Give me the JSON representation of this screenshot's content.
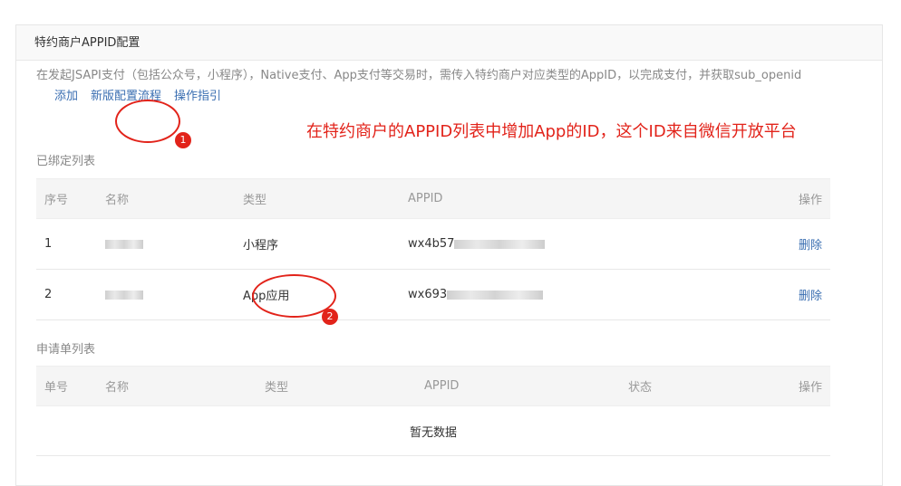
{
  "panel": {
    "title": "特约商户APPID配置"
  },
  "description": {
    "text": "在发起JSAPI支付（包括公众号，小程序），Native支付、App支付等交易时，需传入特约商户对应类型的AppID，以完成支付，并获取sub_openid",
    "links": [
      "添加",
      "新版配置流程",
      "操作指引"
    ]
  },
  "annotation": {
    "text": "在特约商户的APPID列表中增加App的ID，这个ID来自微信开放平台",
    "badges": [
      "1",
      "2"
    ],
    "color": "#e2231a"
  },
  "bound_list": {
    "label": "已绑定列表",
    "headers": [
      "序号",
      "名称",
      "类型",
      "APPID",
      "操作"
    ],
    "rows": [
      {
        "index": "1",
        "type": "小程序",
        "appid": "wx4b57",
        "action": "删除"
      },
      {
        "index": "2",
        "type": "App应用",
        "appid": "wx693",
        "action": "删除"
      }
    ]
  },
  "application_list": {
    "label": "申请单列表",
    "headers": [
      "单号",
      "名称",
      "类型",
      "APPID",
      "状态",
      "操作"
    ],
    "empty_text": "暂无数据"
  },
  "colors": {
    "link": "#3b6fb2",
    "header_bg": "#f5f5f5"
  }
}
